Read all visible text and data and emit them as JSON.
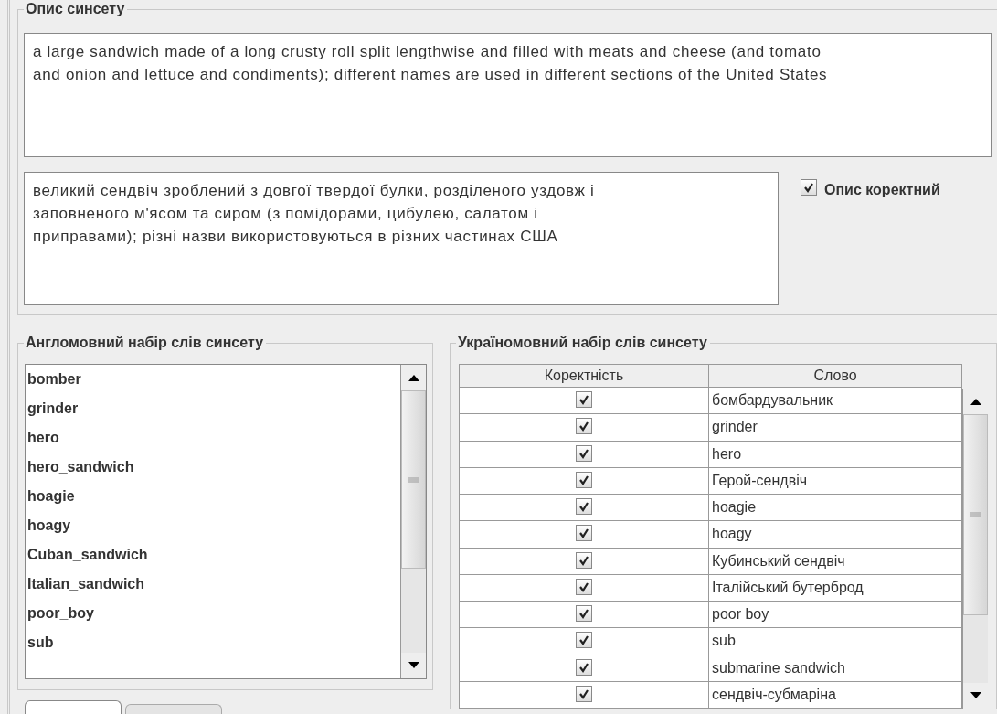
{
  "description_panel": {
    "title": "Опис синсету",
    "english_description": "a large sandwich made of a long crusty roll split lengthwise and filled with meats and cheese (and tomato and onion and lettuce and condiments); different names are used in different sections of the United States",
    "ukrainian_description": "великий сендвіч зроблений з довгої твердої булки, розділеного уздовж і заповненого м'ясом та сиром (з помідорами, цибулею, салатом і приправами); різні назви використовуються в різних частинах США",
    "description_correct": {
      "label": "Опис коректний",
      "checked": true
    }
  },
  "english_words": {
    "title": "Англомовний набір слів синсету",
    "items": [
      "bomber",
      "grinder",
      "hero",
      "hero_sandwich",
      "hoagie",
      "hoagy",
      "Cuban_sandwich",
      "Italian_sandwich",
      "poor_boy",
      "sub"
    ]
  },
  "ukrainian_words": {
    "title": "Україномовний набір слів синсету",
    "columns": [
      "Коректність",
      "Слово"
    ],
    "rows": [
      {
        "correct": true,
        "word": "бомбардувальник"
      },
      {
        "correct": true,
        "word": "grinder"
      },
      {
        "correct": true,
        "word": "hero"
      },
      {
        "correct": true,
        "word": "Герой-сендвіч"
      },
      {
        "correct": true,
        "word": "hoagie"
      },
      {
        "correct": true,
        "word": "hoagy"
      },
      {
        "correct": true,
        "word": "Кубинський сендвіч"
      },
      {
        "correct": true,
        "word": "Італійський бутерброд"
      },
      {
        "correct": true,
        "word": "poor boy"
      },
      {
        "correct": true,
        "word": "sub"
      },
      {
        "correct": true,
        "word": "submarine sandwich"
      },
      {
        "correct": true,
        "word": "сендвіч-субмаріна"
      }
    ]
  },
  "bottom_tabs": [
    {
      "selected": true
    },
    {
      "selected": false
    }
  ]
}
